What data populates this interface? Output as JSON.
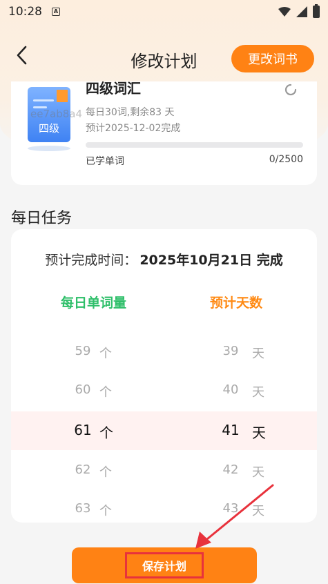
{
  "status_bar": {
    "time": "10:28",
    "app_icon_letter": "A"
  },
  "header": {
    "title": "修改计划",
    "change_book_label": "更改词书"
  },
  "book": {
    "name": "四级词汇",
    "cover_label": "四级",
    "watermark": "ee7ab8a4",
    "daily_info": "每日30词,剩余83 天",
    "expected_info": "预计2025-12-02完成",
    "learned_label": "已学单词",
    "learned_count": "0/2500",
    "progress_fraction": 0
  },
  "daily_task": {
    "section_title": "每日任务",
    "finish_prefix": "预计完成时间：",
    "finish_date": "2025年10月21日 完成",
    "col_words_label": "每日单词量",
    "col_days_label": "预计天数",
    "picker": [
      {
        "words": "59",
        "word_unit": "个",
        "days": "39",
        "day_unit": "天"
      },
      {
        "words": "60",
        "word_unit": "个",
        "days": "40",
        "day_unit": "天"
      },
      {
        "words": "61",
        "word_unit": "个",
        "days": "41",
        "day_unit": "天"
      },
      {
        "words": "62",
        "word_unit": "个",
        "days": "42",
        "day_unit": "天"
      },
      {
        "words": "63",
        "word_unit": "个",
        "days": "43",
        "day_unit": "天"
      }
    ]
  },
  "save_button": {
    "label": "保存计划"
  },
  "colors": {
    "accent": "#ff8214",
    "words_green": "#2fbf6a",
    "days_orange": "#ff8a14",
    "annotation_red": "#e8323c"
  }
}
